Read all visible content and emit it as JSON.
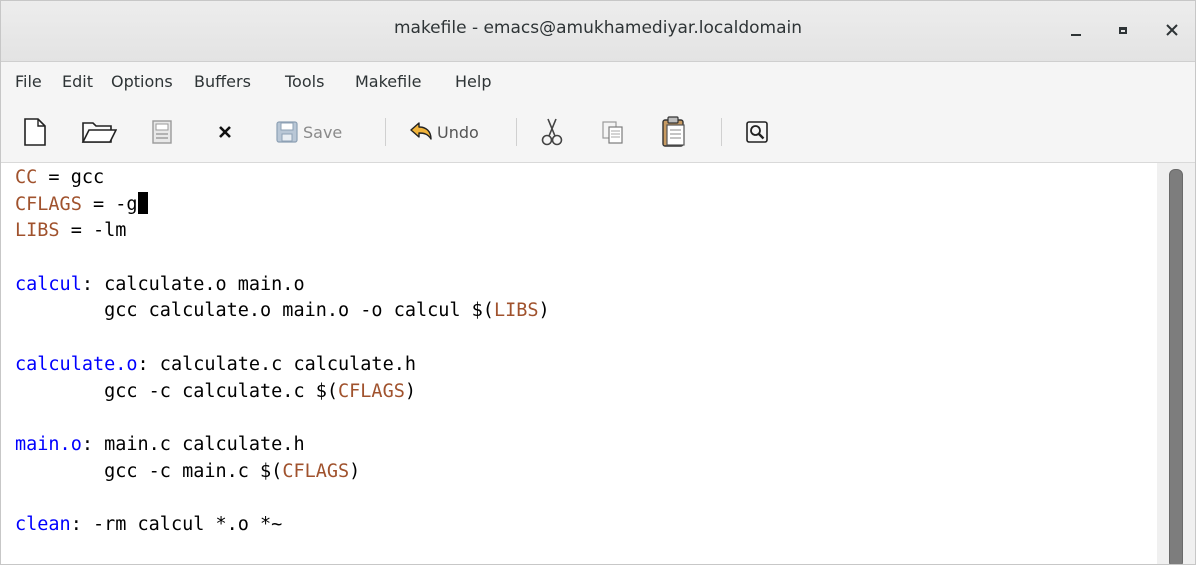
{
  "window": {
    "title": "makefile - emacs@amukhamediyar.localdomain"
  },
  "menu": [
    "File",
    "Edit",
    "Options",
    "Buffers",
    "Tools",
    "Makefile",
    "Help"
  ],
  "toolbar": {
    "new_icon": "new-file-icon",
    "open_icon": "open-folder-icon",
    "disk_icon": "save-disk-icon",
    "close_icon": "close-buffer-icon",
    "save_label": "Save",
    "undo_label": "Undo",
    "cut_icon": "scissors-icon",
    "copy_icon": "copy-icon",
    "paste_icon": "paste-icon",
    "search_icon": "search-icon"
  },
  "buffer": {
    "lines": [
      [
        {
          "t": "CC",
          "c": "var"
        },
        {
          "t": " = gcc",
          "c": ""
        }
      ],
      [
        {
          "t": "CFLAGS",
          "c": "var"
        },
        {
          "t": " = -g",
          "c": ""
        }
      ],
      [
        {
          "t": "LIBS",
          "c": "var"
        },
        {
          "t": " = -lm",
          "c": ""
        }
      ],
      [],
      [
        {
          "t": "calcul",
          "c": "tgt"
        },
        {
          "t": ": calculate.o main.o",
          "c": ""
        }
      ],
      [
        {
          "t": "        gcc calculate.o main.o -o calcul $(",
          "c": ""
        },
        {
          "t": "LIBS",
          "c": "var"
        },
        {
          "t": ")",
          "c": ""
        }
      ],
      [],
      [
        {
          "t": "calculate.o",
          "c": "tgt"
        },
        {
          "t": ": calculate.c calculate.h",
          "c": ""
        }
      ],
      [
        {
          "t": "        gcc -c calculate.c $(",
          "c": ""
        },
        {
          "t": "CFLAGS",
          "c": "var"
        },
        {
          "t": ")",
          "c": ""
        }
      ],
      [],
      [
        {
          "t": "main.o",
          "c": "tgt"
        },
        {
          "t": ": main.c calculate.h",
          "c": ""
        }
      ],
      [
        {
          "t": "        gcc -c main.c $(",
          "c": ""
        },
        {
          "t": "CFLAGS",
          "c": "var"
        },
        {
          "t": ")",
          "c": ""
        }
      ],
      [],
      [
        {
          "t": "clean",
          "c": "tgt"
        },
        {
          "t": ": -rm calcul *.o *~",
          "c": ""
        }
      ]
    ],
    "cursor_line": 1
  },
  "colors": {
    "variable": "#a0522d",
    "target": "#0000ff"
  }
}
